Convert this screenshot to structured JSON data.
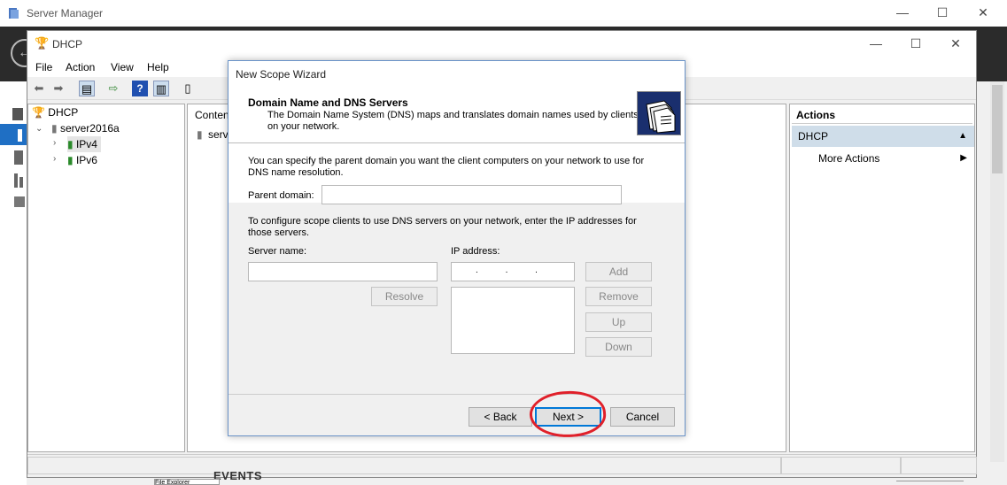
{
  "server_manager": {
    "title": "Server Manager",
    "events_label": "EVENTS",
    "bottom_tab_label": "File Explorer"
  },
  "dhcp_window": {
    "title": "DHCP",
    "menu": [
      "File",
      "Action",
      "View",
      "Help"
    ],
    "tree": {
      "root": "DHCP",
      "server": "server2016a",
      "children": [
        "IPv4",
        "IPv6"
      ]
    },
    "content": {
      "header_partial": "Conten",
      "row_partial": "serv"
    },
    "actions": {
      "header": "Actions",
      "section": "DHCP",
      "item": "More Actions"
    }
  },
  "wizard": {
    "title": "New Scope Wizard",
    "heading": "Domain Name and DNS Servers",
    "subheading": "The Domain Name System (DNS) maps and translates domain names used by clients on your network.",
    "parent_domain_instructions": "You can specify the parent domain you want the client computers on your network to use for DNS name resolution.",
    "parent_domain_label": "Parent domain:",
    "parent_domain_value": "",
    "dns_instructions": "To configure scope clients to use DNS servers on your network, enter the IP addresses for those servers.",
    "server_name_label": "Server name:",
    "server_name_value": "",
    "ip_address_label": "IP address:",
    "ip_address_value": ". . .",
    "buttons": {
      "add": "Add",
      "resolve": "Resolve",
      "remove": "Remove",
      "up": "Up",
      "down": "Down",
      "back": "< Back",
      "next": "Next >",
      "cancel": "Cancel"
    }
  },
  "annotation": {
    "highlight_color": "#e0202a"
  },
  "colors": {
    "accent": "#0078d7",
    "selection": "#cfdde9",
    "dark_band": "#2b2b2b"
  }
}
